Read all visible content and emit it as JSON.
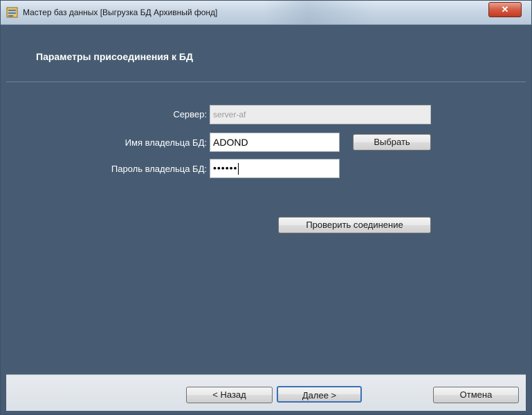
{
  "window": {
    "title": "Мастер баз данных [Выгрузка БД Архивный фонд]",
    "close_label": "✕"
  },
  "header": {
    "title": "Параметры присоединения к БД"
  },
  "form": {
    "server_label": "Сервер:",
    "server_value": "server-af",
    "owner_label": "Имя владельца БД:",
    "owner_value": "ADOND",
    "password_label": "Пароль владельца БД:",
    "password_value": "••••••",
    "select_button": "Выбрать",
    "check_button": "Проверить соединение"
  },
  "footer": {
    "back_button": "< Назад",
    "next_button": "Далее >",
    "cancel_button": "Отмена"
  },
  "colors": {
    "panel": "#475c72",
    "titlebar": "#c8d6e4",
    "close": "#c13a22"
  },
  "icons": {
    "app": "database-wizard-icon",
    "close": "close-icon"
  }
}
